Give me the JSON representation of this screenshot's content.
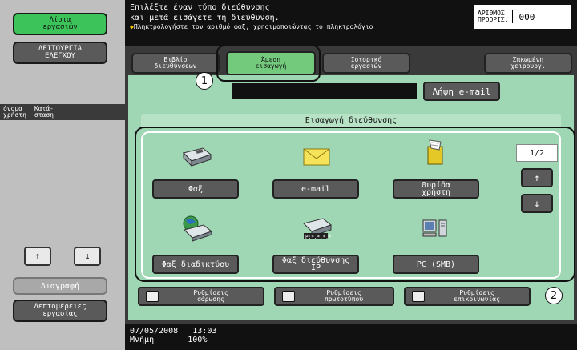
{
  "left_panel": {
    "job_list_btn": "Λίστα\nεργασιών",
    "utility_btn": "ΛΕΙΤΟΥΡΓΙΑ\nΕΛΕΓΧΟΥ",
    "columns": [
      "όνομα\nχρήστη",
      "Κατά-\nσταση"
    ],
    "up_arrow": "↑",
    "down_arrow": "↓",
    "delete_btn": "Διαγραφή",
    "job_details_btn": "Λεπτομέρειες\nεργασίας"
  },
  "header": {
    "line1": "Επιλέξτε έναν τύπο διεύθυνσης",
    "line2": "και μετά εισάγετε τη διεύθυνση.",
    "line3": "Πληκτρολογήστε τον αριθμό φαξ, χρησιμοποιώντας το πληκτρολόγιο",
    "originals_label": "ΑΡΙΘΜΟΣ\nΠΡΟΟΡΙΣ.",
    "originals_count": "000"
  },
  "tabs": {
    "address_book": "Βιβλίο\nδιευθύνσεων",
    "direct_input": "Άμεση\nεισαγωγή",
    "job_history": "Ιστορικό\nεργασιών",
    "address_search": "Σπκωμένη\nχειρουργ."
  },
  "direct_input": {
    "get_email_btn": "Λήψη e-mail",
    "section_title": "Εισαγωγή διεύθυνσης",
    "page_indicator": "1/2",
    "page_up": "↑",
    "page_down": "↓",
    "types": [
      {
        "label": "Φαξ",
        "icon": "fax-icon"
      },
      {
        "label": "e-mail",
        "icon": "envelope-icon"
      },
      {
        "label": "Θυρίδα\nχρήστη",
        "icon": "user-box-icon"
      },
      {
        "label": "Φαξ διαδικτύου",
        "icon": "internet-fax-icon"
      },
      {
        "label": "Φαξ διεύθυνσης\nIP",
        "icon": "ip-fax-icon"
      },
      {
        "label": "PC (SMB)",
        "icon": "pc-icon"
      }
    ]
  },
  "bottom_settings": {
    "scan_settings": "Ρυθμίσεις\nσάρωσης",
    "original_settings": "Ρυθμίσεις\nπρωτοτύπου",
    "comm_settings": "Ρυθμίσεις\nεπικοινωνίας"
  },
  "callouts": {
    "one": "1",
    "two": "2"
  },
  "footer": {
    "date": "07/05/2008",
    "time": "13:03",
    "memory_label": "Μνήμη",
    "memory_value": "100%"
  }
}
